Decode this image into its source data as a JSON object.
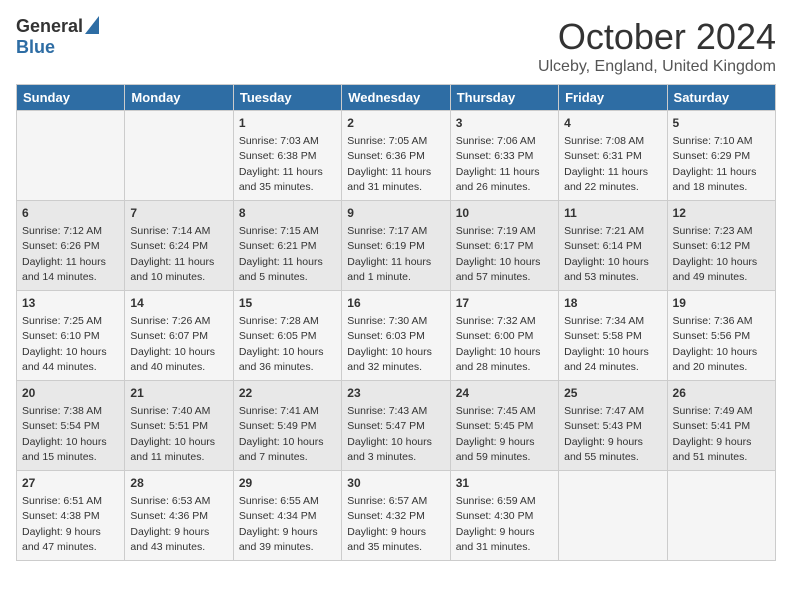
{
  "logo": {
    "general": "General",
    "blue": "Blue"
  },
  "title": "October 2024",
  "location": "Ulceby, England, United Kingdom",
  "days": [
    "Sunday",
    "Monday",
    "Tuesday",
    "Wednesday",
    "Thursday",
    "Friday",
    "Saturday"
  ],
  "weeks": [
    [
      {
        "day": "",
        "sunrise": "",
        "sunset": "",
        "daylight": ""
      },
      {
        "day": "",
        "sunrise": "",
        "sunset": "",
        "daylight": ""
      },
      {
        "day": "1",
        "sunrise": "Sunrise: 7:03 AM",
        "sunset": "Sunset: 6:38 PM",
        "daylight": "Daylight: 11 hours and 35 minutes."
      },
      {
        "day": "2",
        "sunrise": "Sunrise: 7:05 AM",
        "sunset": "Sunset: 6:36 PM",
        "daylight": "Daylight: 11 hours and 31 minutes."
      },
      {
        "day": "3",
        "sunrise": "Sunrise: 7:06 AM",
        "sunset": "Sunset: 6:33 PM",
        "daylight": "Daylight: 11 hours and 26 minutes."
      },
      {
        "day": "4",
        "sunrise": "Sunrise: 7:08 AM",
        "sunset": "Sunset: 6:31 PM",
        "daylight": "Daylight: 11 hours and 22 minutes."
      },
      {
        "day": "5",
        "sunrise": "Sunrise: 7:10 AM",
        "sunset": "Sunset: 6:29 PM",
        "daylight": "Daylight: 11 hours and 18 minutes."
      }
    ],
    [
      {
        "day": "6",
        "sunrise": "Sunrise: 7:12 AM",
        "sunset": "Sunset: 6:26 PM",
        "daylight": "Daylight: 11 hours and 14 minutes."
      },
      {
        "day": "7",
        "sunrise": "Sunrise: 7:14 AM",
        "sunset": "Sunset: 6:24 PM",
        "daylight": "Daylight: 11 hours and 10 minutes."
      },
      {
        "day": "8",
        "sunrise": "Sunrise: 7:15 AM",
        "sunset": "Sunset: 6:21 PM",
        "daylight": "Daylight: 11 hours and 5 minutes."
      },
      {
        "day": "9",
        "sunrise": "Sunrise: 7:17 AM",
        "sunset": "Sunset: 6:19 PM",
        "daylight": "Daylight: 11 hours and 1 minute."
      },
      {
        "day": "10",
        "sunrise": "Sunrise: 7:19 AM",
        "sunset": "Sunset: 6:17 PM",
        "daylight": "Daylight: 10 hours and 57 minutes."
      },
      {
        "day": "11",
        "sunrise": "Sunrise: 7:21 AM",
        "sunset": "Sunset: 6:14 PM",
        "daylight": "Daylight: 10 hours and 53 minutes."
      },
      {
        "day": "12",
        "sunrise": "Sunrise: 7:23 AM",
        "sunset": "Sunset: 6:12 PM",
        "daylight": "Daylight: 10 hours and 49 minutes."
      }
    ],
    [
      {
        "day": "13",
        "sunrise": "Sunrise: 7:25 AM",
        "sunset": "Sunset: 6:10 PM",
        "daylight": "Daylight: 10 hours and 44 minutes."
      },
      {
        "day": "14",
        "sunrise": "Sunrise: 7:26 AM",
        "sunset": "Sunset: 6:07 PM",
        "daylight": "Daylight: 10 hours and 40 minutes."
      },
      {
        "day": "15",
        "sunrise": "Sunrise: 7:28 AM",
        "sunset": "Sunset: 6:05 PM",
        "daylight": "Daylight: 10 hours and 36 minutes."
      },
      {
        "day": "16",
        "sunrise": "Sunrise: 7:30 AM",
        "sunset": "Sunset: 6:03 PM",
        "daylight": "Daylight: 10 hours and 32 minutes."
      },
      {
        "day": "17",
        "sunrise": "Sunrise: 7:32 AM",
        "sunset": "Sunset: 6:00 PM",
        "daylight": "Daylight: 10 hours and 28 minutes."
      },
      {
        "day": "18",
        "sunrise": "Sunrise: 7:34 AM",
        "sunset": "Sunset: 5:58 PM",
        "daylight": "Daylight: 10 hours and 24 minutes."
      },
      {
        "day": "19",
        "sunrise": "Sunrise: 7:36 AM",
        "sunset": "Sunset: 5:56 PM",
        "daylight": "Daylight: 10 hours and 20 minutes."
      }
    ],
    [
      {
        "day": "20",
        "sunrise": "Sunrise: 7:38 AM",
        "sunset": "Sunset: 5:54 PM",
        "daylight": "Daylight: 10 hours and 15 minutes."
      },
      {
        "day": "21",
        "sunrise": "Sunrise: 7:40 AM",
        "sunset": "Sunset: 5:51 PM",
        "daylight": "Daylight: 10 hours and 11 minutes."
      },
      {
        "day": "22",
        "sunrise": "Sunrise: 7:41 AM",
        "sunset": "Sunset: 5:49 PM",
        "daylight": "Daylight: 10 hours and 7 minutes."
      },
      {
        "day": "23",
        "sunrise": "Sunrise: 7:43 AM",
        "sunset": "Sunset: 5:47 PM",
        "daylight": "Daylight: 10 hours and 3 minutes."
      },
      {
        "day": "24",
        "sunrise": "Sunrise: 7:45 AM",
        "sunset": "Sunset: 5:45 PM",
        "daylight": "Daylight: 9 hours and 59 minutes."
      },
      {
        "day": "25",
        "sunrise": "Sunrise: 7:47 AM",
        "sunset": "Sunset: 5:43 PM",
        "daylight": "Daylight: 9 hours and 55 minutes."
      },
      {
        "day": "26",
        "sunrise": "Sunrise: 7:49 AM",
        "sunset": "Sunset: 5:41 PM",
        "daylight": "Daylight: 9 hours and 51 minutes."
      }
    ],
    [
      {
        "day": "27",
        "sunrise": "Sunrise: 6:51 AM",
        "sunset": "Sunset: 4:38 PM",
        "daylight": "Daylight: 9 hours and 47 minutes."
      },
      {
        "day": "28",
        "sunrise": "Sunrise: 6:53 AM",
        "sunset": "Sunset: 4:36 PM",
        "daylight": "Daylight: 9 hours and 43 minutes."
      },
      {
        "day": "29",
        "sunrise": "Sunrise: 6:55 AM",
        "sunset": "Sunset: 4:34 PM",
        "daylight": "Daylight: 9 hours and 39 minutes."
      },
      {
        "day": "30",
        "sunrise": "Sunrise: 6:57 AM",
        "sunset": "Sunset: 4:32 PM",
        "daylight": "Daylight: 9 hours and 35 minutes."
      },
      {
        "day": "31",
        "sunrise": "Sunrise: 6:59 AM",
        "sunset": "Sunset: 4:30 PM",
        "daylight": "Daylight: 9 hours and 31 minutes."
      },
      {
        "day": "",
        "sunrise": "",
        "sunset": "",
        "daylight": ""
      },
      {
        "day": "",
        "sunrise": "",
        "sunset": "",
        "daylight": ""
      }
    ]
  ]
}
